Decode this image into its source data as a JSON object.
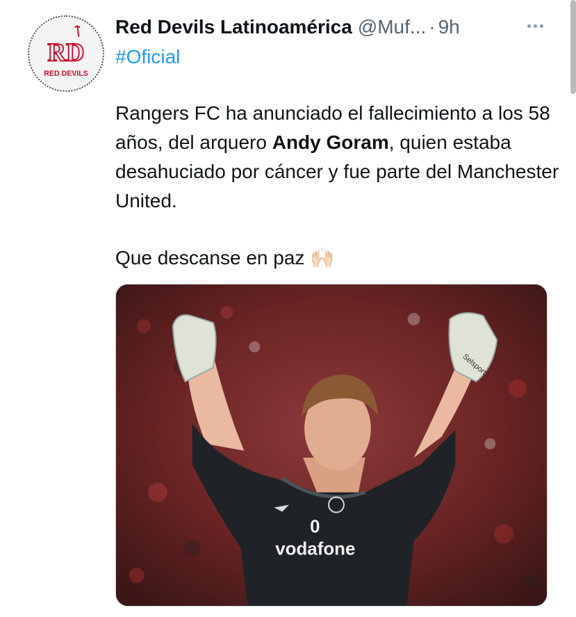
{
  "tweet": {
    "display_name": "Red Devils Latinoamérica",
    "handle": "@Muf...",
    "separator": "·",
    "time": "9h",
    "hashtag": "#Oficial",
    "avatar": {
      "monogram": "RD",
      "caption": "RED DEVILS"
    },
    "body": {
      "line1_pre": "Rangers FC ha anunciado el fallecimiento a los 58 años, del arquero ",
      "line1_bold": "Andy Goram",
      "line1_post": ", quien estaba desahuciado por cáncer y fue parte del Manchester United.",
      "line2": "Que descanse en paz 🙌🏻"
    },
    "media": {
      "shirt_text": "vodafone",
      "glove_brand": "Selsport",
      "icon": "photo-of-goalkeeper-celebrating"
    }
  },
  "colors": {
    "link": "#1d9bf0",
    "muted": "#536471",
    "text": "#0f1419",
    "brand_red": "#c8102e"
  }
}
